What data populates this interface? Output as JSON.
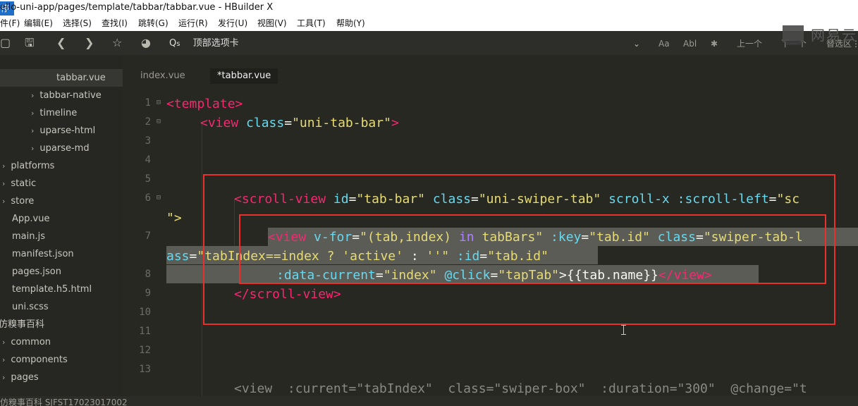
{
  "title_bar": {
    "badge": "停",
    "title": "ello-uni-app/pages/template/tabbar/tabbar.vue - HBuilder X"
  },
  "menu_bar": [
    "件(F)",
    "编辑(E)",
    "选择(S)",
    "查找(I)",
    "跳转(G)",
    "运行(R)",
    "发行(U)",
    "视图(V)",
    "工具(T)",
    "帮助(Y)"
  ],
  "toolbar": {
    "search_value": "顶部选项卡",
    "prev_label": "上一个",
    "next_label": "下一个",
    "selection_label": "替选区",
    "case_label": "Aa",
    "word_label": "Abl"
  },
  "logo": {
    "text": "网易云"
  },
  "sidebar": {
    "selected_file": "tabbar.vue",
    "items": [
      {
        "label": "tabbar-native",
        "chevron": "›"
      },
      {
        "label": "timeline",
        "chevron": "›"
      },
      {
        "label": "uparse-html",
        "chevron": "›"
      },
      {
        "label": "uparse-md",
        "chevron": "›"
      },
      {
        "label": "platforms",
        "chevron": "›"
      },
      {
        "label": "static",
        "chevron": "›"
      },
      {
        "label": "store",
        "chevron": "›"
      },
      {
        "label": "App.vue",
        "chevron": ""
      },
      {
        "label": "main.js",
        "chevron": ""
      },
      {
        "label": "manifest.json",
        "chevron": ""
      },
      {
        "label": "pages.json",
        "chevron": ""
      },
      {
        "label": "template.h5.html",
        "chevron": ""
      },
      {
        "label": "uni.scss",
        "chevron": ""
      },
      {
        "label": "仿糗事百科",
        "chevron": ""
      },
      {
        "label": "common",
        "chevron": "›"
      },
      {
        "label": "components",
        "chevron": "›"
      },
      {
        "label": "pages",
        "chevron": "›"
      }
    ]
  },
  "tabs": [
    {
      "label": "index.vue",
      "active": false
    },
    {
      "label": "*tabbar.vue",
      "active": true
    }
  ],
  "line_numbers": [
    "1",
    "2",
    "3",
    "4",
    "5",
    "6",
    "7",
    "8",
    "9",
    "10",
    "11",
    "12",
    "13"
  ],
  "code": {
    "l1": {
      "tag": "<template>"
    },
    "l2": {
      "open": "<view",
      "attr": "class",
      "eq": "=",
      "val": "\"uni-tab-bar\"",
      "close": ">"
    },
    "l6": {
      "open": "<scroll-view",
      "a1": "id",
      "v1": "\"tab-bar\"",
      "a2": "class",
      "v2": "\"uni-swiper-tab\"",
      "a3": "scroll-x",
      "a4": ":scroll-left",
      "v4": "\"sc"
    },
    "l6b": "\">",
    "l7": {
      "open": "<view",
      "a1": "v-for",
      "v1": "\"(tab,index)",
      "kw": "in",
      "v1b": "tabBars\"",
      "a2": ":key",
      "v2": "\"tab.id\"",
      "a3": "class",
      "v3": "\"swiper-tab-l"
    },
    "l7b": {
      "p1": "ass",
      "v1": "\"tabIndex==index ?",
      "s1": "'active'",
      "p2": ":",
      "s2": "''\"",
      "a1": ":id",
      "v2": "\"tab.id\""
    },
    "l8": {
      "a1": ":data-current",
      "v1": "\"index\"",
      "a2": "@click",
      "v2": "\"tapTab\"",
      "p1": ">{{tab.name}}",
      "close": "</view>"
    },
    "l9": {
      "tag": "</scroll-view>"
    },
    "l13_partial": "<view  :current=\"tabIndex\"  class=\"swiper-box\"  :duration=\"300\"  @change=\"t"
  },
  "status_bar": "仿糗事百科    SJFST17023017002"
}
